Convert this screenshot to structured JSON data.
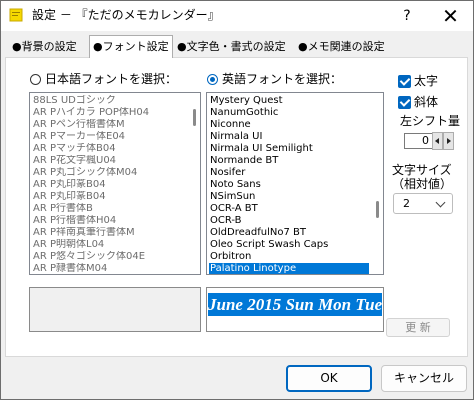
{
  "window": {
    "title": "設定 － 『ただのメモカレンダー』",
    "help_glyph": "?",
    "close_glyph": "✕"
  },
  "tabs": [
    {
      "label": "●背景の設定",
      "active": false
    },
    {
      "label": "●フォント設定",
      "active": true
    },
    {
      "label": "●文字色・書式の設定",
      "active": false
    },
    {
      "label": "●メモ関連の設定",
      "active": false
    }
  ],
  "japanese_font": {
    "radio_label": "日本語フォントを選択：",
    "selected": false,
    "items": [
      "88LS UDゴシック",
      "AR Pハイカラ POP体H04",
      "AR Pペン行楷書体M",
      "AR Pマーカー体E04",
      "AR Pマッチ体B04",
      "AR P花文字楓U04",
      "AR P丸ゴシック体M04",
      "AR P丸印篆B04",
      "AR P丸印篆B04",
      "AR P行書体B",
      "AR P行楷書体H04",
      "AR P祥南真筆行書体M",
      "AR P明朝体L04",
      "AR P悠々ゴシック体04E",
      "AR P隷書体M04"
    ]
  },
  "english_font": {
    "radio_label": "英語フォントを選択：",
    "selected": true,
    "items": [
      "Mystery Quest",
      "NanumGothic",
      "Niconne",
      "Nirmala UI",
      "Nirmala UI Semilight",
      "Normande BT",
      "Nosifer",
      "Noto Sans",
      "NSimSun",
      "OCR-A BT",
      "OCR-B",
      "OldDreadfulNo7 BT",
      "Oleo Script Swash Caps",
      "Orbitron",
      "Palatino Linotype"
    ],
    "selected_item": "Palatino Linotype"
  },
  "options": {
    "bold_label": "太字",
    "bold_checked": true,
    "italic_label": "斜体",
    "italic_checked": true,
    "left_shift_label": "左シフト量",
    "left_shift_value": "0",
    "font_size_label_line1": "文字サイズ",
    "font_size_label_line2": "（相対値）",
    "font_size_value": "2"
  },
  "preview": {
    "sample_text": "June 2015 Sun Mon Tue"
  },
  "buttons": {
    "update_label": "更 新",
    "ok_label": "OK",
    "cancel_label": "キャンセル"
  },
  "colors": {
    "accent": "#0067c0",
    "selection": "#0078d7",
    "disabled_text": "#6d6d6d"
  }
}
